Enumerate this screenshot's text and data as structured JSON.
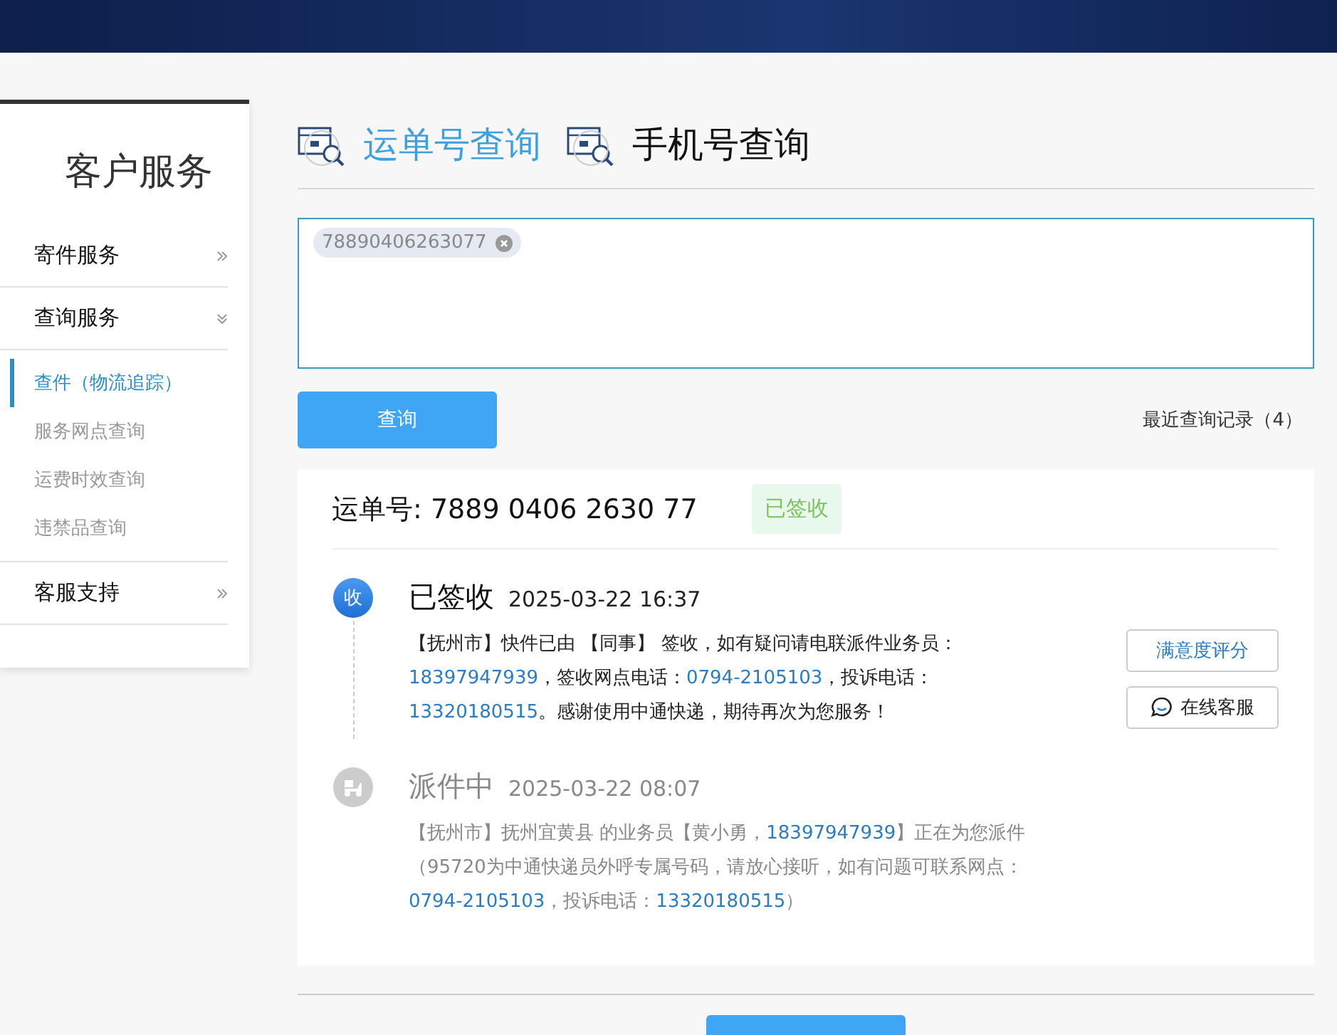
{
  "sidebar": {
    "title": "客户服务",
    "sections": [
      {
        "label": "寄件服务",
        "expanded": false
      },
      {
        "label": "查询服务",
        "expanded": true,
        "items": [
          {
            "label": "查件（物流追踪）",
            "selected": true
          },
          {
            "label": "服务网点查询",
            "selected": false
          },
          {
            "label": "运费时效查询",
            "selected": false
          },
          {
            "label": "违禁品查询",
            "selected": false
          }
        ]
      },
      {
        "label": "客服支持",
        "expanded": false
      }
    ]
  },
  "tabs": [
    {
      "label": "运单号查询",
      "selected": true
    },
    {
      "label": "手机号查询",
      "selected": false
    }
  ],
  "query_field": {
    "tags": [
      "78890406263077"
    ]
  },
  "query_button": "查询",
  "recent_link": "最近查询记录（4）",
  "result": {
    "waybill": "运单号: 7889 0406 2630 77",
    "status": "已签收",
    "events": [
      {
        "kind": "received",
        "current": true,
        "icon_text": "收",
        "title": "已签收",
        "time": "2025-03-22 16:37",
        "description": [
          {
            "kind": "text",
            "text": "【抚州市】快件已由 【同事】 签收，如有疑问请电联派件业务员："
          },
          {
            "kind": "phone",
            "text": "18397947939"
          },
          {
            "kind": "text",
            "text": "，签收网点电话："
          },
          {
            "kind": "phone",
            "text": "0794-2105103"
          },
          {
            "kind": "text",
            "text": "，投诉电话："
          },
          {
            "kind": "phone",
            "text": "13320180515"
          },
          {
            "kind": "text",
            "text": "。感谢使用中通快递，期待再次为您服务！"
          }
        ]
      },
      {
        "kind": "delivering",
        "current": false,
        "title": "派件中",
        "time": "2025-03-22 08:07",
        "description": [
          {
            "kind": "text",
            "text": "【抚州市】抚州宜黄县 的业务员【黄小勇，"
          },
          {
            "kind": "phone",
            "text": "18397947939"
          },
          {
            "kind": "text",
            "text": "】正在为您派件（95720为中通快递员外呼专属号码，请放心接听，如有问题可联系网点："
          },
          {
            "kind": "phone",
            "text": "0794-2105103"
          },
          {
            "kind": "text",
            "text": "，投诉电话："
          },
          {
            "kind": "phone",
            "text": "13320180515"
          },
          {
            "kind": "text",
            "text": "）"
          }
        ]
      }
    ],
    "actions": [
      {
        "kind": "rate",
        "label": "满意度评分"
      },
      {
        "kind": "chat",
        "label": "在线客服"
      }
    ]
  }
}
